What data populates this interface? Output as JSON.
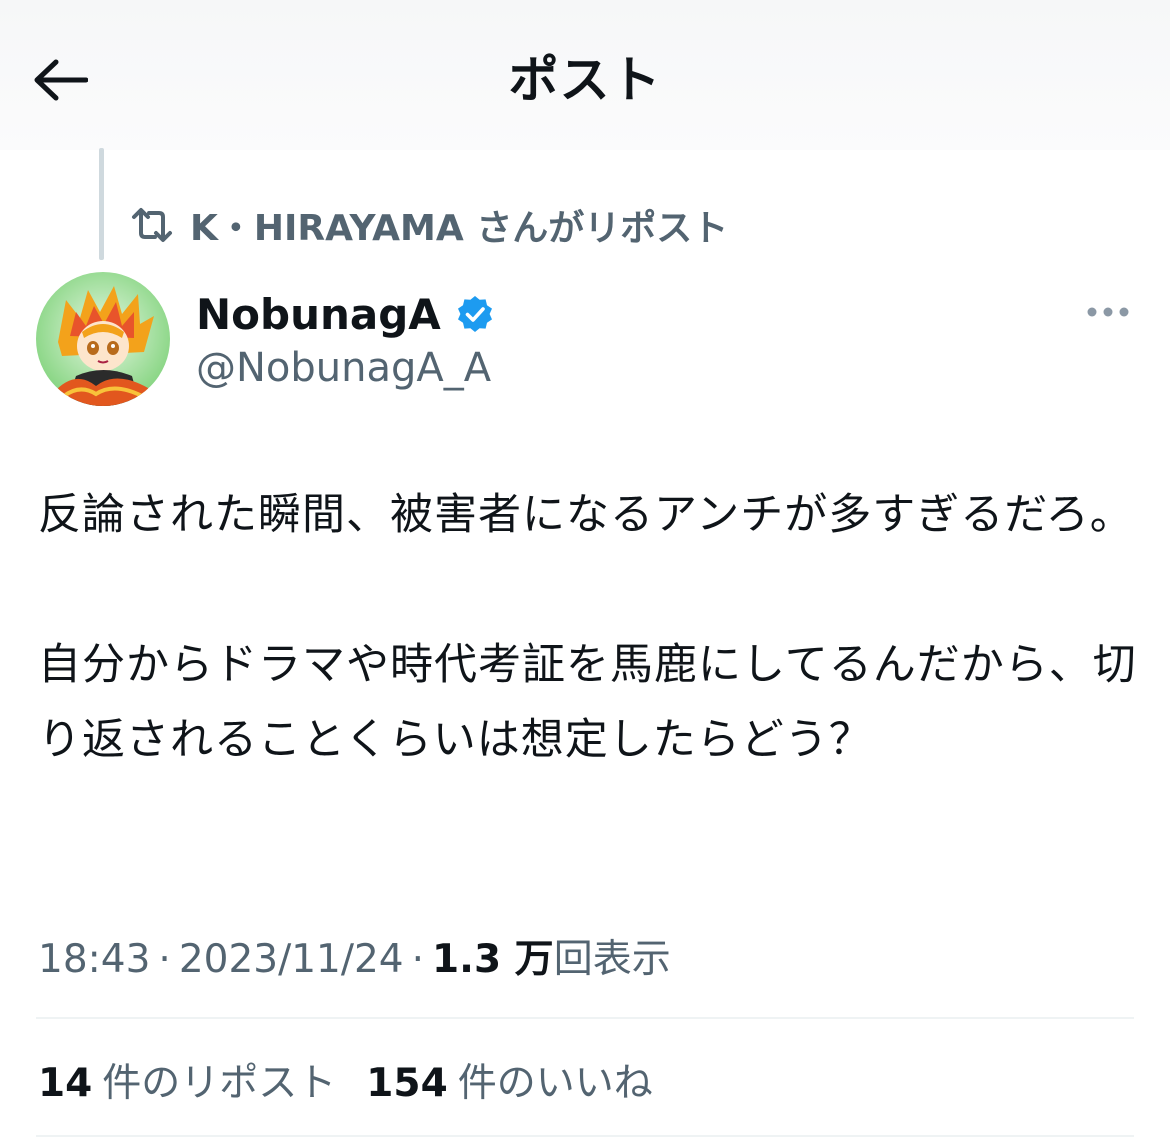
{
  "header": {
    "back_icon": "arrow-left-icon",
    "title": "ポスト"
  },
  "repost_context": {
    "icon": "repost-icon",
    "text": "K・HIRAYAMA さんがリポスト"
  },
  "author": {
    "name": "NobunagA",
    "verified_icon": "verified-badge-icon",
    "verified_color": "#1d9bf0",
    "handle": "@NobunagA_A"
  },
  "post": {
    "paragraphs": [
      "反論された瞬間、被害者になるアンチが多すぎるだろ。",
      "自分からドラマや時代考証を馬鹿にしてるんだから、切り返されることくらいは想定したらどう？"
    ]
  },
  "meta": {
    "time": "18:43",
    "separator": "·",
    "date": "2023/11/24",
    "views_count": "1.3 万",
    "views_label": "回表示"
  },
  "stats": {
    "reposts_count": "14",
    "reposts_label": "件のリポスト",
    "likes_count": "154",
    "likes_label": "件のいいね"
  },
  "colors": {
    "text_primary": "#0f1419",
    "text_secondary": "#536471",
    "divider": "#eff3f4"
  }
}
